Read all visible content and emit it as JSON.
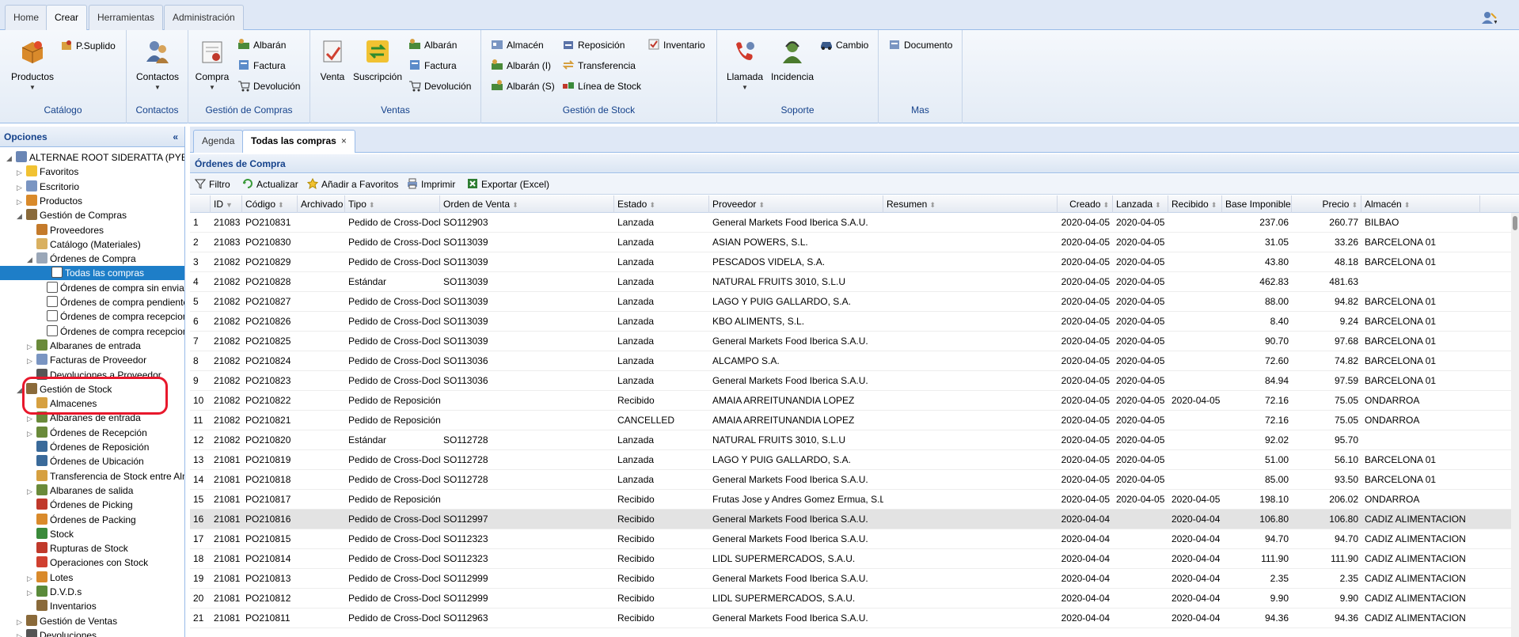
{
  "top_tabs": [
    "Home",
    "Crear",
    "Herramientas",
    "Administración"
  ],
  "ribbon": {
    "groups": [
      {
        "name": "Catálogo",
        "big": [
          "Productos"
        ],
        "small": [
          "P.Suplido"
        ]
      },
      {
        "name": "Contactos",
        "big": [
          "Contactos"
        ],
        "small": []
      },
      {
        "name": "Gestión de Compras",
        "big": [
          "Compra"
        ],
        "small": [
          "Albarán",
          "Factura",
          "Devolución"
        ]
      },
      {
        "name": "Ventas",
        "big": [
          "Venta",
          "Suscripción"
        ],
        "small": [
          "Albarán",
          "Factura",
          "Devolución"
        ]
      },
      {
        "name": "Gestión de Stock",
        "big": [],
        "small": [
          "Almacén",
          "Albarán (I)",
          "Albarán (S)",
          "Reposición",
          "Transferencia",
          "Línea de Stock",
          "Inventario"
        ]
      },
      {
        "name": "Soporte",
        "big": [
          "Llamada",
          "Incidencia"
        ],
        "small": [
          "Cambio"
        ]
      },
      {
        "name": "Mas",
        "big": [],
        "small": [
          "Documento"
        ]
      }
    ]
  },
  "left_panel": {
    "title": "Opciones",
    "collapse_glyph": "«",
    "tree": [
      {
        "label": "ALTERNAE ROOT SIDERATTA (PYB)",
        "level": 0,
        "exp": "◢"
      },
      {
        "label": "Favoritos",
        "level": 1,
        "exp": "▷"
      },
      {
        "label": "Escritorio",
        "level": 1,
        "exp": "▷"
      },
      {
        "label": "Productos",
        "level": 1,
        "exp": "▷"
      },
      {
        "label": "Gestión de Compras",
        "level": 1,
        "exp": "◢"
      },
      {
        "label": "Proveedores",
        "level": 2,
        "exp": ""
      },
      {
        "label": "Catálogo (Materiales)",
        "level": 2,
        "exp": ""
      },
      {
        "label": "Órdenes de Compra",
        "level": 2,
        "exp": "◢"
      },
      {
        "label": "Todas las compras",
        "level": 3,
        "exp": "",
        "selected": true
      },
      {
        "label": "Órdenes de compra sin enviar",
        "level": 3,
        "exp": ""
      },
      {
        "label": "Órdenes de compra pendientes",
        "level": 3,
        "exp": ""
      },
      {
        "label": "Órdenes de compra recepcionadas",
        "level": 3,
        "exp": ""
      },
      {
        "label": "Órdenes de compra recepcionadas parcialmente",
        "level": 3,
        "exp": ""
      },
      {
        "label": "Albaranes de entrada",
        "level": 2,
        "exp": "▷"
      },
      {
        "label": "Facturas de Proveedor",
        "level": 2,
        "exp": "▷"
      },
      {
        "label": "Devoluciones a Proveedor",
        "level": 2,
        "exp": ""
      },
      {
        "label": "Gestión de Stock",
        "level": 1,
        "exp": "◢"
      },
      {
        "label": "Almacenes",
        "level": 2,
        "exp": ""
      },
      {
        "label": "Albaranes de entrada",
        "level": 2,
        "exp": "▷"
      },
      {
        "label": "Órdenes de Recepción",
        "level": 2,
        "exp": "▷"
      },
      {
        "label": "Órdenes de Reposición",
        "level": 2,
        "exp": ""
      },
      {
        "label": "Órdenes de Ubicación",
        "level": 2,
        "exp": ""
      },
      {
        "label": "Transferencia de Stock entre Almacenes",
        "level": 2,
        "exp": ""
      },
      {
        "label": "Albaranes de salida",
        "level": 2,
        "exp": "▷"
      },
      {
        "label": "Órdenes de Picking",
        "level": 2,
        "exp": ""
      },
      {
        "label": "Órdenes de Packing",
        "level": 2,
        "exp": ""
      },
      {
        "label": "Stock",
        "level": 2,
        "exp": ""
      },
      {
        "label": "Rupturas de Stock",
        "level": 2,
        "exp": ""
      },
      {
        "label": "Operaciones con Stock",
        "level": 2,
        "exp": ""
      },
      {
        "label": "Lotes",
        "level": 2,
        "exp": "▷"
      },
      {
        "label": "D.V.D.s",
        "level": 2,
        "exp": "▷"
      },
      {
        "label": "Inventarios",
        "level": 2,
        "exp": ""
      },
      {
        "label": "Gestión de Ventas",
        "level": 1,
        "exp": "▷"
      },
      {
        "label": "Devoluciones",
        "level": 1,
        "exp": "▷"
      }
    ]
  },
  "main_tabs": [
    {
      "label": "Agenda"
    },
    {
      "label": "Todas las compras",
      "close": "×"
    }
  ],
  "panel_title": "Órdenes de Compra",
  "toolbar": [
    "Filtro",
    "Actualizar",
    "Añadir a Favoritos",
    "Imprimir",
    "Exportar (Excel)"
  ],
  "grid": {
    "columns": [
      "",
      "ID",
      "Código",
      "Archivado",
      "Tipo",
      "Orden de Venta",
      "Estado",
      "Proveedor",
      "Resumen",
      "Creado",
      "Lanzada",
      "Recibido",
      "Base Imponible",
      "Precio",
      "Almacén"
    ],
    "selected_row": 16,
    "rows": [
      [
        "1",
        "21083",
        "PO210831",
        "",
        "Pedido de Cross-Dock",
        "SO112903",
        "Lanzada",
        "General Markets Food Iberica S.A.U.",
        "",
        "2020-04-05",
        "2020-04-05",
        "",
        "237.06",
        "260.77",
        "BILBAO"
      ],
      [
        "2",
        "21083",
        "PO210830",
        "",
        "Pedido de Cross-Dock",
        "SO113039",
        "Lanzada",
        "ASIAN POWERS, S.L.",
        "",
        "2020-04-05",
        "2020-04-05",
        "",
        "31.05",
        "33.26",
        "BARCELONA 01"
      ],
      [
        "3",
        "21082",
        "PO210829",
        "",
        "Pedido de Cross-Dock",
        "SO113039",
        "Lanzada",
        "PESCADOS VIDELA, S.A.",
        "",
        "2020-04-05",
        "2020-04-05",
        "",
        "43.80",
        "48.18",
        "BARCELONA 01"
      ],
      [
        "4",
        "21082",
        "PO210828",
        "",
        "Estándar",
        "SO113039",
        "Lanzada",
        "NATURAL FRUITS 3010, S.L.U",
        "",
        "2020-04-05",
        "2020-04-05",
        "",
        "462.83",
        "481.63",
        ""
      ],
      [
        "5",
        "21082",
        "PO210827",
        "",
        "Pedido de Cross-Dock",
        "SO113039",
        "Lanzada",
        "LAGO Y PUIG GALLARDO, S.A.",
        "",
        "2020-04-05",
        "2020-04-05",
        "",
        "88.00",
        "94.82",
        "BARCELONA 01"
      ],
      [
        "6",
        "21082",
        "PO210826",
        "",
        "Pedido de Cross-Dock",
        "SO113039",
        "Lanzada",
        "KBO ALIMENTS, S.L.",
        "",
        "2020-04-05",
        "2020-04-05",
        "",
        "8.40",
        "9.24",
        "BARCELONA 01"
      ],
      [
        "7",
        "21082",
        "PO210825",
        "",
        "Pedido de Cross-Dock",
        "SO113039",
        "Lanzada",
        "General Markets Food Iberica S.A.U.",
        "",
        "2020-04-05",
        "2020-04-05",
        "",
        "90.70",
        "97.68",
        "BARCELONA 01"
      ],
      [
        "8",
        "21082",
        "PO210824",
        "",
        "Pedido de Cross-Dock",
        "SO113036",
        "Lanzada",
        "ALCAMPO S.A.",
        "",
        "2020-04-05",
        "2020-04-05",
        "",
        "72.60",
        "74.82",
        "BARCELONA 01"
      ],
      [
        "9",
        "21082",
        "PO210823",
        "",
        "Pedido de Cross-Dock",
        "SO113036",
        "Lanzada",
        "General Markets Food Iberica S.A.U.",
        "",
        "2020-04-05",
        "2020-04-05",
        "",
        "84.94",
        "97.59",
        "BARCELONA 01"
      ],
      [
        "10",
        "21082",
        "PO210822",
        "",
        "Pedido de Reposición",
        "",
        "Recibido",
        "AMAIA ARREITUNANDIA LOPEZ",
        "",
        "2020-04-05",
        "2020-04-05",
        "2020-04-05",
        "72.16",
        "75.05",
        "ONDARROA"
      ],
      [
        "11",
        "21082",
        "PO210821",
        "",
        "Pedido de Reposición",
        "",
        "CANCELLED",
        "AMAIA ARREITUNANDIA LOPEZ",
        "",
        "2020-04-05",
        "2020-04-05",
        "",
        "72.16",
        "75.05",
        "ONDARROA"
      ],
      [
        "12",
        "21082",
        "PO210820",
        "",
        "Estándar",
        "SO112728",
        "Lanzada",
        "NATURAL FRUITS 3010, S.L.U",
        "",
        "2020-04-05",
        "2020-04-05",
        "",
        "92.02",
        "95.70",
        ""
      ],
      [
        "13",
        "21081",
        "PO210819",
        "",
        "Pedido de Cross-Dock",
        "SO112728",
        "Lanzada",
        "LAGO Y PUIG GALLARDO, S.A.",
        "",
        "2020-04-05",
        "2020-04-05",
        "",
        "51.00",
        "56.10",
        "BARCELONA 01"
      ],
      [
        "14",
        "21081",
        "PO210818",
        "",
        "Pedido de Cross-Dock",
        "SO112728",
        "Lanzada",
        "General Markets Food Iberica S.A.U.",
        "",
        "2020-04-05",
        "2020-04-05",
        "",
        "85.00",
        "93.50",
        "BARCELONA 01"
      ],
      [
        "15",
        "21081",
        "PO210817",
        "",
        "Pedido de Reposición",
        "",
        "Recibido",
        "Frutas Jose y Andres Gomez Ermua, S.L.",
        "",
        "2020-04-05",
        "2020-04-05",
        "2020-04-05",
        "198.10",
        "206.02",
        "ONDARROA"
      ],
      [
        "16",
        "21081",
        "PO210816",
        "",
        "Pedido de Cross-Dock",
        "SO112997",
        "Recibido",
        "General Markets Food Iberica S.A.U.",
        "",
        "2020-04-04",
        "",
        "2020-04-04",
        "106.80",
        "106.80",
        "CADIZ ALIMENTACION"
      ],
      [
        "17",
        "21081",
        "PO210815",
        "",
        "Pedido de Cross-Dock",
        "SO112323",
        "Recibido",
        "General Markets Food Iberica S.A.U.",
        "",
        "2020-04-04",
        "",
        "2020-04-04",
        "94.70",
        "94.70",
        "CADIZ ALIMENTACION"
      ],
      [
        "18",
        "21081",
        "PO210814",
        "",
        "Pedido de Cross-Dock",
        "SO112323",
        "Recibido",
        "LIDL SUPERMERCADOS, S.A.U.",
        "",
        "2020-04-04",
        "",
        "2020-04-04",
        "111.90",
        "111.90",
        "CADIZ ALIMENTACION"
      ],
      [
        "19",
        "21081",
        "PO210813",
        "",
        "Pedido de Cross-Dock",
        "SO112999",
        "Recibido",
        "General Markets Food Iberica S.A.U.",
        "",
        "2020-04-04",
        "",
        "2020-04-04",
        "2.35",
        "2.35",
        "CADIZ ALIMENTACION"
      ],
      [
        "20",
        "21081",
        "PO210812",
        "",
        "Pedido de Cross-Dock",
        "SO112999",
        "Recibido",
        "LIDL SUPERMERCADOS, S.A.U.",
        "",
        "2020-04-04",
        "",
        "2020-04-04",
        "9.90",
        "9.90",
        "CADIZ ALIMENTACION"
      ],
      [
        "21",
        "21081",
        "PO210811",
        "",
        "Pedido de Cross-Dock",
        "SO112963",
        "Recibido",
        "General Markets Food Iberica S.A.U.",
        "",
        "2020-04-04",
        "",
        "2020-04-04",
        "94.36",
        "94.36",
        "CADIZ ALIMENTACION"
      ]
    ]
  }
}
